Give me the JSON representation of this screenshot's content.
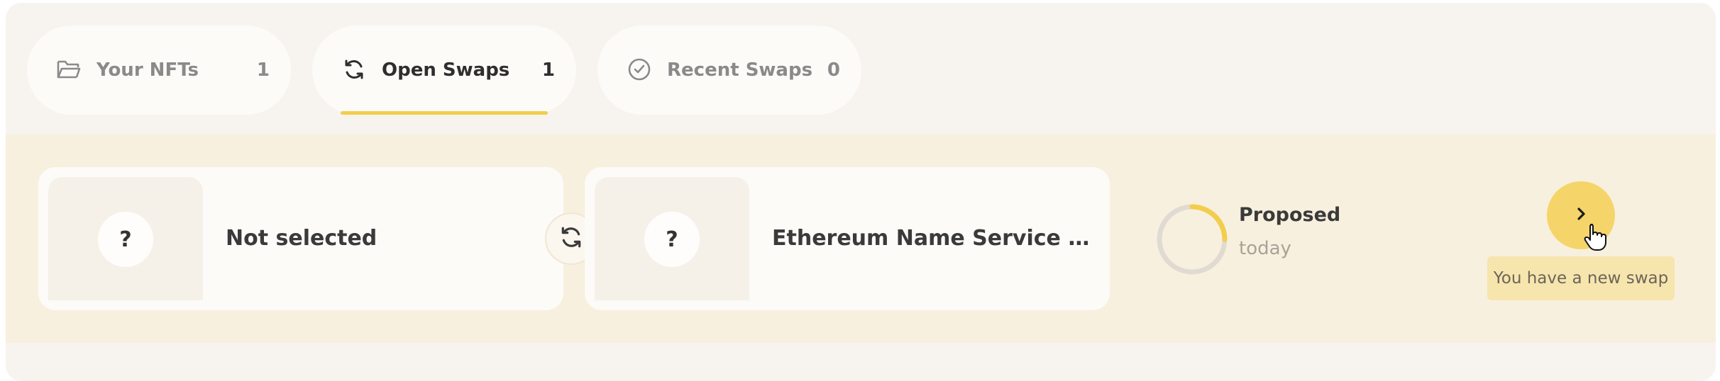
{
  "tabs": [
    {
      "label": "Your NFTs",
      "count": "1",
      "icon": "folder-open-icon",
      "active": false
    },
    {
      "label": "Open Swaps",
      "count": "1",
      "icon": "refresh-icon",
      "active": true
    },
    {
      "label": "Recent Swaps",
      "count": "0",
      "icon": "check-circle-icon",
      "active": false
    }
  ],
  "swap": {
    "left_nft": {
      "placeholder": "?",
      "title": "Not selected"
    },
    "right_nft": {
      "placeholder": "?",
      "title": "Ethereum Name Service (ENS)"
    },
    "status": {
      "label": "Proposed",
      "time": "today",
      "progress": 0.25
    },
    "tooltip": "You have a new swap"
  },
  "colors": {
    "panel_bg": "#f7f4ef",
    "row_bg": "#f8f0de",
    "accent": "#f3cd4b",
    "button": "#f5d56a",
    "tooltip_bg": "#f7e5ae"
  }
}
